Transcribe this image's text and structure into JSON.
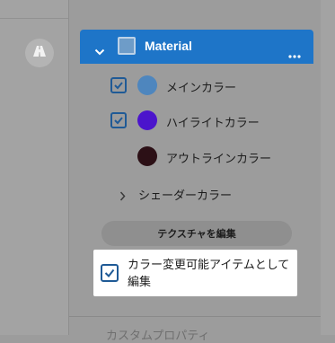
{
  "material_panel": {
    "title": "Material",
    "header_swatch_color": "#6e9cc8",
    "accent_color": "#1e75c8",
    "items": [
      {
        "label": "メインカラー",
        "checked": true,
        "color": "#4e86be"
      },
      {
        "label": "ハイライトカラー",
        "checked": true,
        "color": "#4b14cc"
      },
      {
        "label": "アウトラインカラー",
        "checked": false,
        "color": "#2c1016"
      }
    ],
    "shader_label": "シェーダーカラー",
    "texture_button_label": "テクスチャを編集",
    "option_label": "カラー変更可能アイテムとして編集",
    "option_checked": true
  },
  "below_text": "カスタムプロパティ"
}
